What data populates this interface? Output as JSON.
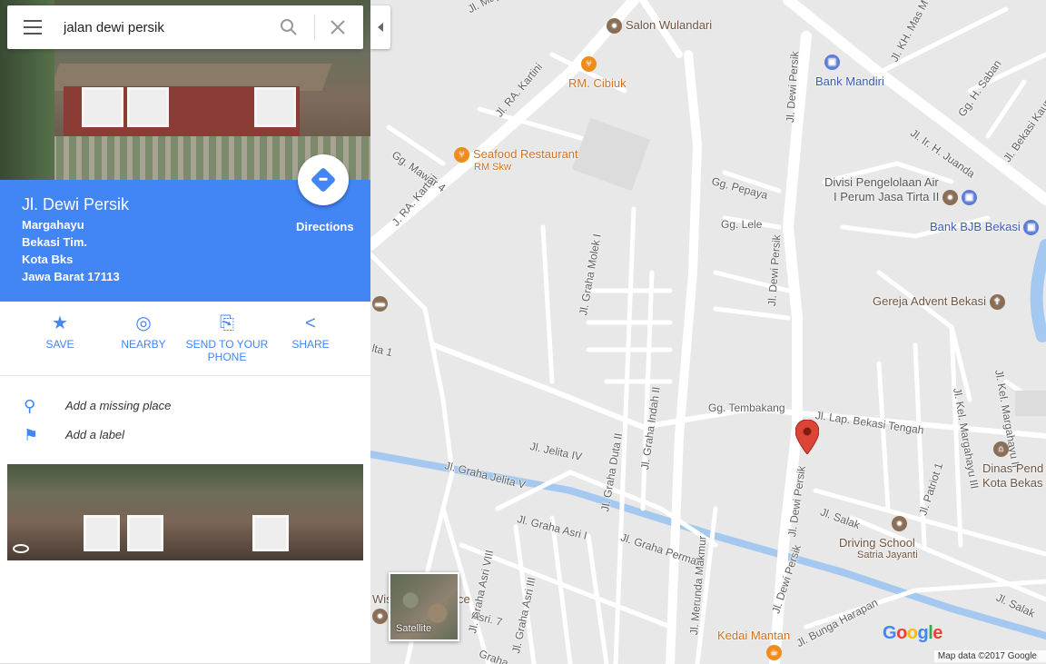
{
  "search": {
    "value": "jalan dewi persik"
  },
  "place": {
    "title": "Jl. Dewi Persik",
    "address": [
      "Margahayu",
      "Bekasi Tim.",
      "Kota Bks",
      "Jawa Barat 17113"
    ],
    "directions_label": "Directions"
  },
  "actions": [
    {
      "label": "SAVE",
      "icon": "star-icon"
    },
    {
      "label": "NEARBY",
      "icon": "nearby-icon"
    },
    {
      "label": "SEND TO YOUR PHONE",
      "icon": "send-to-phone-icon"
    },
    {
      "label": "SHARE",
      "icon": "share-icon"
    }
  ],
  "extras": [
    {
      "label": "Add a missing place",
      "icon": "add-place-icon"
    },
    {
      "label": "Add a label",
      "icon": "flag-icon"
    }
  ],
  "map": {
    "satellite_label": "Satellite",
    "attribution": "Map data ©2017 Google",
    "logo": "Google",
    "streets": {
      "mayor_oking": "Jl. Mayor Oking",
      "ra_kartini_1": "Jl. RA. Kartini",
      "ra_kartini_2": "J. RA. Kartini",
      "mawar": "Gg. Mawar 4",
      "dewi_persik_1": "Jl. Dewi Persik",
      "dewi_persik_2": "Jl. Dewi Persik",
      "dewi_persik_3": "Jl. Dewi Persik",
      "dewi_persik_4": "Jl. Dewi Persik",
      "kh_mas": "Jl. KH. Mas M",
      "saban": "Gg. H. Saban",
      "juanda": "Jl. Ir. H. Juanda",
      "bekasi_kaum": "Jl. Bekasi Kaum",
      "pepaya": "Gg. Pepaya",
      "lele": "Gg. Lele",
      "graha_molek": "Jl. Graha Molek I",
      "tembakang": "Gg. Tembakang",
      "lap_bekasi": "Jl. Lap. Bekasi Tengah",
      "kel_marg_3": "Jl. Kel. Margahayu III",
      "kel_marg_2": "Jl. Kel. Margahayu II",
      "jelita_iv": "Jl. Jelita IV",
      "graha_duta": "Jl. Graha Duta II",
      "graha_indah": "Jl. Graha Indah II",
      "graha_jelita": "Jl. Graha Jelita V",
      "graha_asri": "Jl. Graha Asri I",
      "graha_permai": "Jl. Graha Permai",
      "salak_1": "Jl. Salak",
      "salak_2": "Jl. Salak",
      "patriot": "Jl. Patriot 1",
      "asri_viii": "Jl. Graha Asri VIII",
      "asri_iii": "Jl. Graha Asri III",
      "asri_7": "Asri. 7",
      "merunda": "Jl. Merunda Makmur",
      "bunga_harapan": "Jl. Bunga Harapan",
      "graha_partial": "Graha",
      "lta": "lta 1"
    },
    "pois": {
      "salon": "Salon Wulandari",
      "cibiuk": "RM. Cibiuk",
      "bank_mandiri": "Bank Mandiri",
      "seafood": "Seafood Restaurant",
      "seafood_sub": "RM Skw",
      "divisi": "Divisi Pengelolaan Air",
      "divisi_2": "I Perum Jasa Tirta II",
      "bjb": "Bank BJB Bekasi",
      "gereja": "Gereja Advent Bekasi",
      "dinas": "Dinas Pend",
      "dinas_2": "Kota Bekas",
      "driving": "Driving School",
      "driving_sub": "Satria Jayanti",
      "kedai": "Kedai Mantan",
      "wisma": "Wism",
      "wisma_2": "ce"
    }
  },
  "colors": {
    "accent": "#4285f4",
    "map_bg": "#e8e8e8",
    "road": "#ffffff",
    "river": "#a4c8ef",
    "marker": "#db4437"
  }
}
